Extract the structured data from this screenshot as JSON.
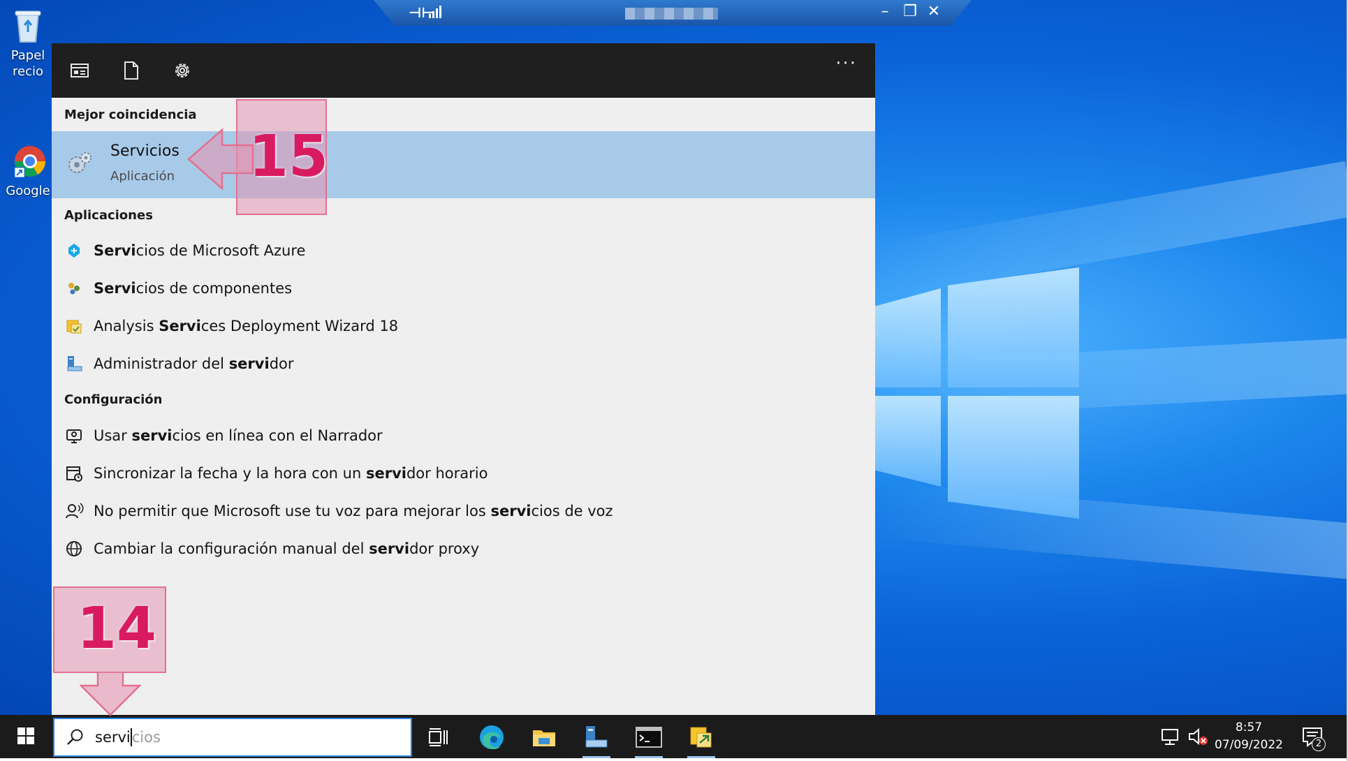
{
  "remote_bar": {
    "pin_glyph": "⊣⊢",
    "minimize_glyph": "–",
    "restore_glyph": "❐",
    "close_glyph": "✕"
  },
  "desktop": {
    "icons": [
      {
        "label_line1": "Papel",
        "label_line2": "recio"
      },
      {
        "label_line1": "Google",
        "label_line2": ""
      }
    ]
  },
  "search_panel": {
    "more_glyph": "···",
    "best_match": {
      "section_label": "Mejor coincidencia",
      "title_bold": "Serv",
      "title_rest": "icios",
      "subtitle": "Aplicación"
    },
    "apps": {
      "section_label": "Aplicaciones",
      "items": [
        {
          "pre": "",
          "bold": "Servi",
          "post": "cios de Microsoft Azure"
        },
        {
          "pre": "",
          "bold": "Servi",
          "post": "cios de componentes"
        },
        {
          "pre": "Analysis ",
          "bold": "Servi",
          "post": "ces Deployment Wizard 18"
        },
        {
          "pre": "Administrador del ",
          "bold": "servi",
          "post": "dor"
        }
      ]
    },
    "settings": {
      "section_label": "Configuración",
      "items": [
        {
          "pre": "Usar ",
          "bold": "servi",
          "post": "cios en línea con el Narrador"
        },
        {
          "pre": "Sincronizar la fecha y la hora con un ",
          "bold": "servi",
          "post": "dor horario"
        },
        {
          "pre": "No permitir que Microsoft use tu voz para mejorar los ",
          "bold": "servi",
          "post": "cios de voz"
        },
        {
          "pre": "Cambiar la configuración manual del ",
          "bold": "servi",
          "post": "dor proxy"
        }
      ]
    }
  },
  "taskbar": {
    "search_typed": "servi",
    "search_ghost": "cios",
    "clock_time": "8:57",
    "clock_date": "07/09/2022",
    "notification_count": "2"
  },
  "callouts": {
    "step_search": "14",
    "step_result": "15"
  },
  "colors": {
    "accent": "#2b82d9",
    "best_match_bg": "#a7cae9",
    "callout_fill": "#e496b2",
    "callout_text": "#d81b60"
  }
}
